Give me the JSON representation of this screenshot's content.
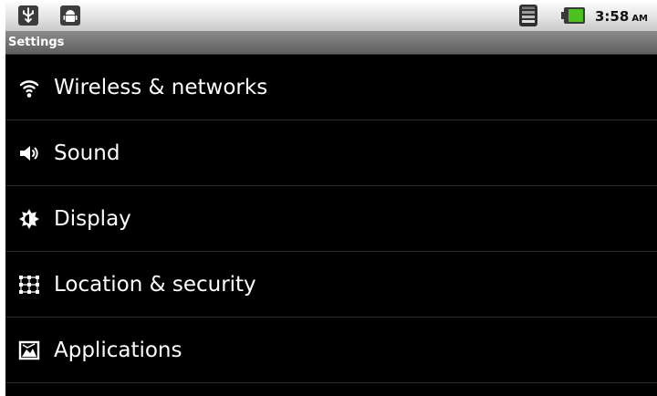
{
  "status_bar": {
    "icons": [
      "usb-debug-icon",
      "android-notification-icon",
      "wifi-signal-icon",
      "battery-icon"
    ],
    "time": "3:58",
    "ampm": "AM"
  },
  "title_bar": {
    "title": "Settings"
  },
  "settings_list": {
    "items": [
      {
        "icon": "wifi-icon",
        "label": "Wireless & networks"
      },
      {
        "icon": "speaker-icon",
        "label": "Sound"
      },
      {
        "icon": "brightness-icon",
        "label": "Display"
      },
      {
        "icon": "location-grid-icon",
        "label": "Location & security"
      },
      {
        "icon": "applications-icon",
        "label": "Applications"
      }
    ]
  },
  "colors": {
    "background": "#000000",
    "title_bar": "#6e6e6e",
    "status_bar": "#e4e4e4",
    "battery_green": "#4cc21c"
  }
}
